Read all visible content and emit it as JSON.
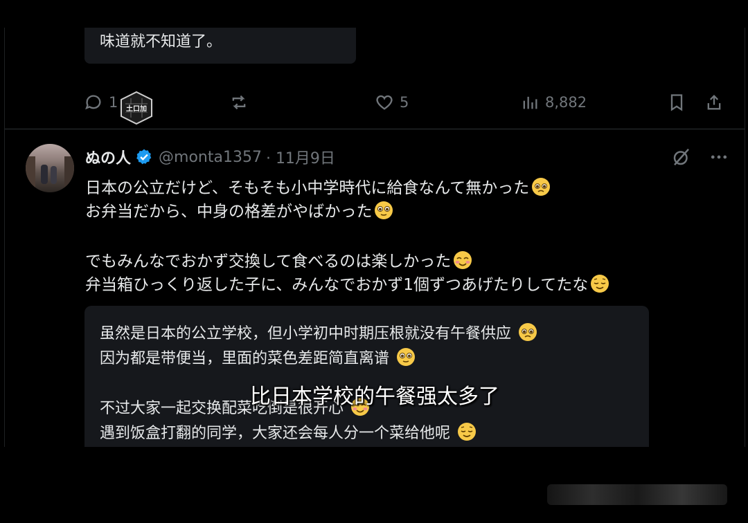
{
  "previous_post": {
    "translation_tail": "味道就不知道了。"
  },
  "actions": {
    "reply_count": "1",
    "like_count": "5",
    "views_count": "8,882"
  },
  "tweet": {
    "author_name": "ぬの人",
    "handle": "@monta1357",
    "date": "· 11月9日",
    "lines": [
      "日本の公立だけど、そもそも小中学時代に給食なんて無かった",
      "お弁当だから、中身の格差がやばかった",
      "でもみんなでおかず交換して食べるのは楽しかった",
      "弁当箱ひっくり返した子に、みんなでおかず1個ずつあげたりしてたな"
    ],
    "translation": [
      "虽然是日本的公立学校，但小学初中时期压根就没有午餐供应",
      "因为都是带便当，里面的菜色差距简直离谱",
      "不过大家一起交换配菜吃倒是很开心",
      "遇到饭盒打翻的同学，大家还会每人分一个菜给他呢"
    ]
  },
  "subtitle": "比日本学校的午餐强太多了",
  "colors": {
    "background": "#000000",
    "muted": "#71767b",
    "text": "#e7e9ea",
    "verified": "#1d9bf0",
    "card": "#16181c"
  }
}
